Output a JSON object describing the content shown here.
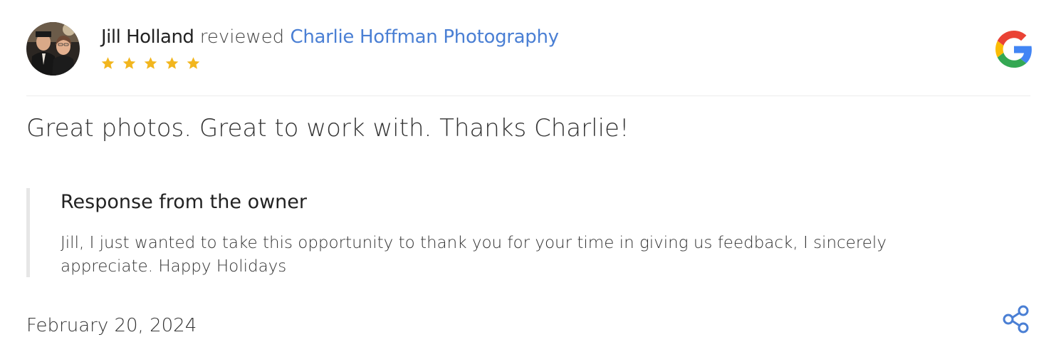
{
  "review": {
    "reviewer_name": "Jill Holland",
    "reviewed_word": "reviewed",
    "business_name": "Charlie Hoffman Photography",
    "rating": 5,
    "rating_max": 5,
    "text": "Great photos. Great to work with. Thanks Charlie!",
    "date": "February 20, 2024",
    "avatar_icon": "reviewer-photo-avatar",
    "source_icon": "google-g-icon"
  },
  "owner_response": {
    "title": "Response from the owner",
    "text": "Jill, I just wanted to take this opportunity to thank you for your time in giving us feedback, I sincerely appreciate. Happy Holidays"
  },
  "actions": {
    "share_icon": "share-icon"
  },
  "colors": {
    "link": "#4a7fd4",
    "star": "#f2b61e",
    "share": "#4a7fd4",
    "divider": "#ececec",
    "response_border": "#e6e6e6"
  }
}
